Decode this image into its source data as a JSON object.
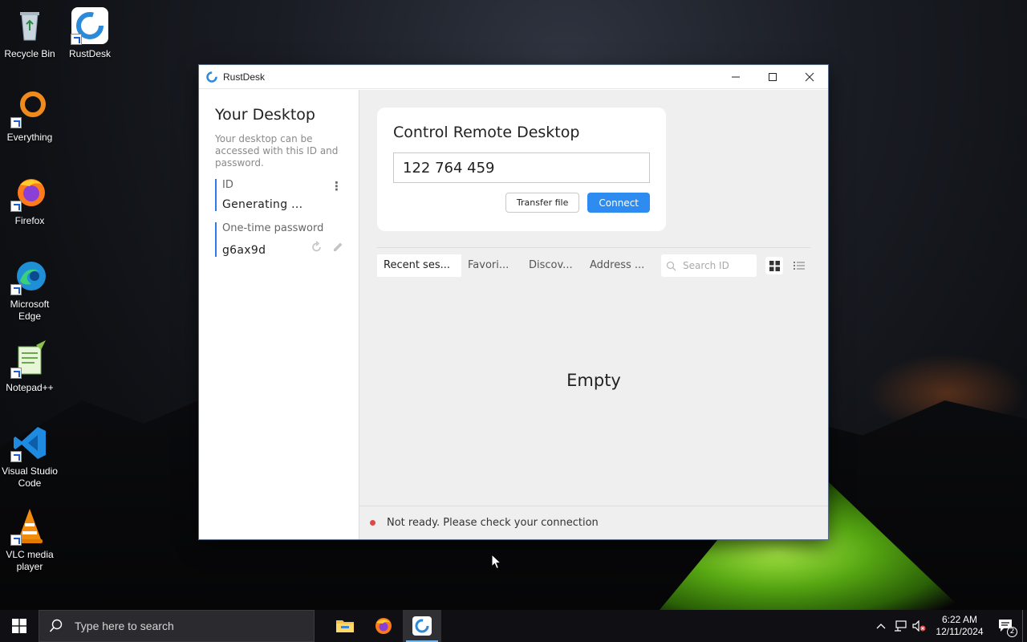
{
  "desktop": {
    "icons": [
      {
        "label": "Recycle Bin"
      },
      {
        "label": "RustDesk"
      },
      {
        "label": "Everything"
      },
      {
        "label": "Firefox"
      },
      {
        "label": "Microsoft Edge"
      },
      {
        "label": "Notepad++"
      },
      {
        "label": "Visual Studio Code"
      },
      {
        "label": "VLC media player"
      }
    ]
  },
  "window": {
    "title": "RustDesk",
    "left": {
      "heading": "Your Desktop",
      "description": "Your desktop can be accessed with this ID and password.",
      "id_label": "ID",
      "id_value": "Generating ...",
      "password_label": "One-time password",
      "password_value": "g6ax9d"
    },
    "control": {
      "heading": "Control Remote Desktop",
      "id_input_value": "122 764 459",
      "transfer_label": "Transfer file",
      "connect_label": "Connect"
    },
    "tabs": [
      "Recent ses...",
      "Favori...",
      "Discov...",
      "Address ..."
    ],
    "search_placeholder": "Search ID",
    "empty_text": "Empty",
    "status_text": "Not ready. Please check your connection",
    "colors": {
      "accent": "#2e8bf0",
      "status_dot": "#e04848"
    }
  },
  "taskbar": {
    "search_placeholder": "Type here to search",
    "time": "6:22 AM",
    "date": "12/11/2024",
    "notification_count": "2"
  }
}
